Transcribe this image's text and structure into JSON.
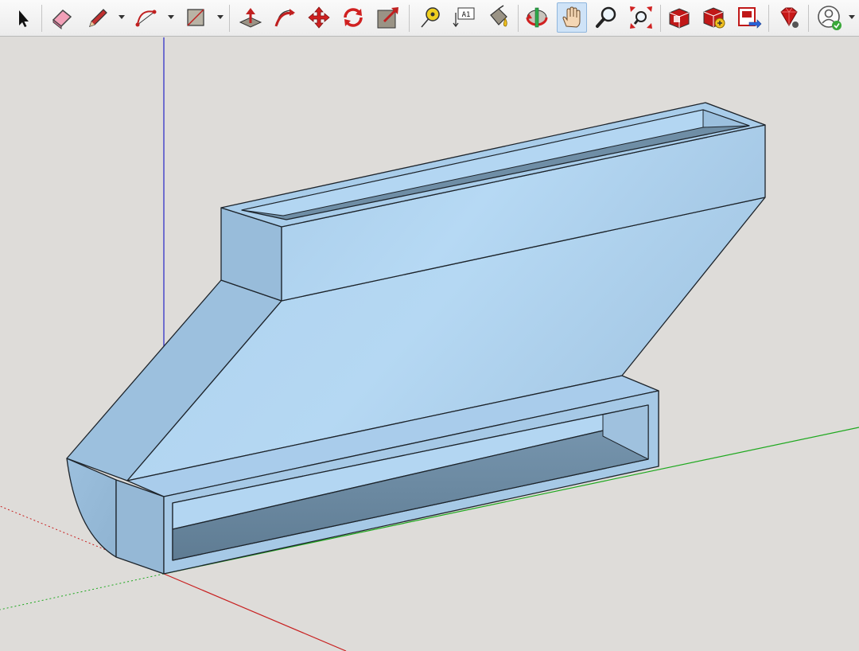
{
  "toolbar": {
    "tools": [
      {
        "id": "select",
        "icon": "select-arrow-icon",
        "active": false,
        "has_dropdown": false
      },
      {
        "id": "eraser",
        "icon": "eraser-icon",
        "active": false,
        "has_dropdown": false
      },
      {
        "id": "pencil-line",
        "icon": "pencil-icon",
        "active": false,
        "has_dropdown": true
      },
      {
        "id": "arc",
        "icon": "arc-icon",
        "active": false,
        "has_dropdown": true
      },
      {
        "id": "rectangle",
        "icon": "rectangle-icon",
        "active": false,
        "has_dropdown": true
      },
      {
        "id": "push-pull",
        "icon": "push-pull-icon",
        "active": false,
        "has_dropdown": false
      },
      {
        "id": "follow-me",
        "icon": "follow-me-icon",
        "active": false,
        "has_dropdown": false
      },
      {
        "id": "move",
        "icon": "move-icon",
        "active": false,
        "has_dropdown": false
      },
      {
        "id": "rotate",
        "icon": "rotate-icon",
        "active": false,
        "has_dropdown": false
      },
      {
        "id": "scale",
        "icon": "scale-icon",
        "active": false,
        "has_dropdown": false
      },
      {
        "id": "tape-measure",
        "icon": "tape-measure-icon",
        "active": false,
        "has_dropdown": false
      },
      {
        "id": "text",
        "icon": "text-label-icon",
        "active": false,
        "has_dropdown": false,
        "label": "A1"
      },
      {
        "id": "paint-bucket",
        "icon": "paint-bucket-icon",
        "active": false,
        "has_dropdown": false
      },
      {
        "id": "orbit",
        "icon": "orbit-icon",
        "active": false,
        "has_dropdown": false
      },
      {
        "id": "pan",
        "icon": "pan-hand-icon",
        "active": true,
        "has_dropdown": false
      },
      {
        "id": "zoom",
        "icon": "zoom-magnifier-icon",
        "active": false,
        "has_dropdown": false
      },
      {
        "id": "zoom-extents",
        "icon": "zoom-extents-icon",
        "active": false,
        "has_dropdown": false
      },
      {
        "id": "3d-warehouse",
        "icon": "warehouse-icon",
        "active": false,
        "has_dropdown": false
      },
      {
        "id": "extension-warehouse",
        "icon": "extension-warehouse-icon",
        "active": false,
        "has_dropdown": false
      },
      {
        "id": "send-to-layout",
        "icon": "send-to-layout-icon",
        "active": false,
        "has_dropdown": false
      },
      {
        "id": "ruby-console",
        "icon": "ruby-gem-icon",
        "active": false,
        "has_dropdown": false
      },
      {
        "id": "account",
        "icon": "user-account-icon",
        "active": false,
        "has_dropdown": true
      }
    ]
  },
  "viewport": {
    "model": "duct-transition",
    "colors": {
      "background": "#dedcd9",
      "face_light": "#b3d6f2",
      "face_mid": "#a2c6e4",
      "face_shadow": "#8fb0cc",
      "face_dark": "#6f8ea6",
      "edge": "#1d242b",
      "axis_red": "#c82020",
      "axis_green": "#1ea81e",
      "axis_blue": "#2323c8"
    }
  }
}
